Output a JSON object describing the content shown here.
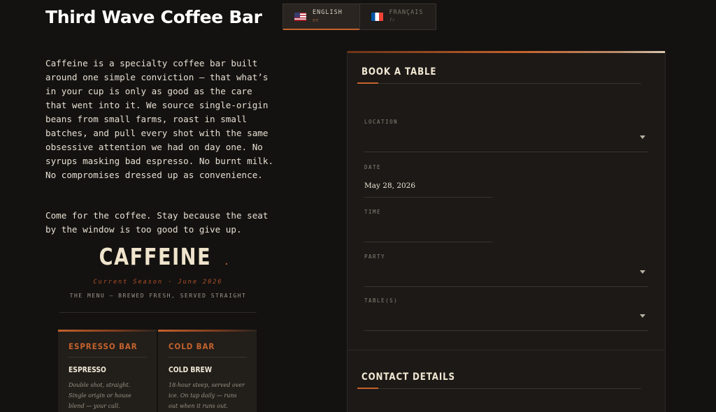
{
  "page": {
    "title": "Third Wave Coffee Bar",
    "intro_paragraphs": [
      "Caffeine is a specialty coffee bar built around one simple conviction — that what’s in your cup is only as good as the care that went into it. We source single-origin beans from small farms, roast in small batches, and pull every shot with the same obsessive attention we had on day one. No syrups masking bad espresso. No burnt milk. No compromises dressed up as convenience.",
      "Come for the coffee. Stay because the seat by the window is too good to give up."
    ]
  },
  "brand": {
    "name": "CAFFEINE",
    "dot": ".",
    "season": "Current Season · June 2026",
    "tagline": "THE MENU — BREWED FRESH, SERVED STRAIGHT"
  },
  "menu": [
    {
      "section": "ESPRESSO BAR",
      "item": "ESPRESSO",
      "description": "Double shot, straight. Single origin or house blend — your call."
    },
    {
      "section": "COLD BAR",
      "item": "COLD BREW",
      "description": "18-hour steep, served over ice. On tap daily — runs out when it runs out."
    }
  ],
  "language": {
    "options": [
      {
        "name": "ENGLISH",
        "code": "en",
        "flag": "us-flag-icon",
        "active": true
      },
      {
        "name": "FRANÇAIS",
        "code": "fr",
        "flag": "fr-flag-icon",
        "active": false
      }
    ]
  },
  "booking": {
    "title": "BOOK A TABLE",
    "fields": {
      "location": {
        "label": "LOCATION",
        "value": ""
      },
      "date": {
        "label": "DATE",
        "value": "May 28, 2026"
      },
      "time": {
        "label": "TIME",
        "value": ""
      },
      "party": {
        "label": "PARTY",
        "value": ""
      },
      "tables": {
        "label": "TABLE(S)",
        "value": ""
      }
    },
    "contact_title": "CONTACT DETAILS"
  },
  "colors": {
    "background": "#141210",
    "accent": "#c4622d",
    "panel": "#1c1916"
  }
}
